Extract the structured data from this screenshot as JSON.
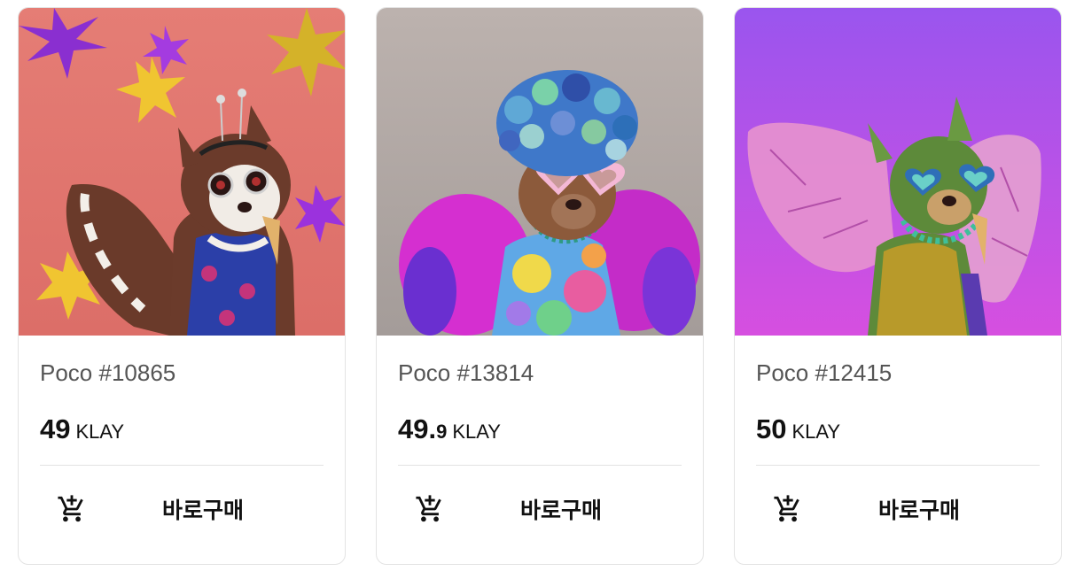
{
  "cards": [
    {
      "name": "Poco #10865",
      "price_int": "49",
      "price_dec": "",
      "price_unit": "KLAY",
      "buy_label": "바로구매",
      "cart_icon": "cart-icon",
      "bg_color": "#e07a72"
    },
    {
      "name": "Poco #13814",
      "price_int": "49.",
      "price_dec": "9",
      "price_unit": "KLAY",
      "buy_label": "바로구매",
      "cart_icon": "cart-icon",
      "bg_color": "#b8afac"
    },
    {
      "name": "Poco #12415",
      "price_int": "50",
      "price_dec": "",
      "price_unit": "KLAY",
      "buy_label": "바로구매",
      "cart_icon": "cart-icon",
      "bg_color": "#a64ee8"
    }
  ]
}
